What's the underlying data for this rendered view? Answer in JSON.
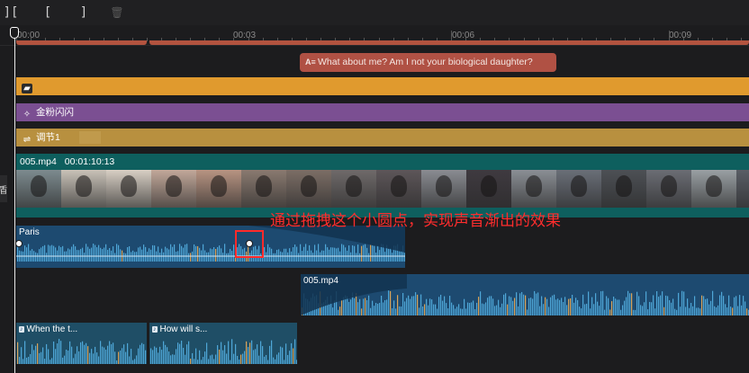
{
  "toolbar": {
    "buttons": [
      {
        "name": "split-icon",
        "glyph": "][",
        "enabled": true
      },
      {
        "name": "trim-start-icon",
        "glyph": "[",
        "enabled": true
      },
      {
        "name": "trim-end-icon",
        "glyph": "]",
        "enabled": true
      },
      {
        "name": "delete-icon",
        "glyph": "🗑",
        "enabled": false
      }
    ]
  },
  "ruler": {
    "labels": [
      "00:00",
      "00:03",
      "00:06",
      "00:09"
    ]
  },
  "text_clip": {
    "icon": "A≡",
    "text": "What about me? Am I not your biological daughter?"
  },
  "tracks": {
    "sticker": {
      "icon": "sticker-icon",
      "color": "#e09a2e"
    },
    "effect": {
      "label": "金粉闪闪",
      "icon": "effect-icon",
      "color": "#7b4f92"
    },
    "adjust": {
      "label": "调节1",
      "icon": "adjust-icon",
      "color": "#b8903f"
    }
  },
  "video_clip": {
    "filename": "005.mp4",
    "duration": "00:01:10:13",
    "color": "#0e5f5e"
  },
  "audio_clips": {
    "paris": {
      "label": "Paris",
      "fade_out": true
    },
    "main": {
      "label": "005.mp4",
      "fade_in": true
    },
    "clip_a": {
      "label": "When the t..."
    },
    "clip_b": {
      "label": "How will s..."
    }
  },
  "annotation": {
    "text": "通过拖拽这个小圆点，实现声音渐出的效果"
  },
  "left_edge_glyph": "盾"
}
